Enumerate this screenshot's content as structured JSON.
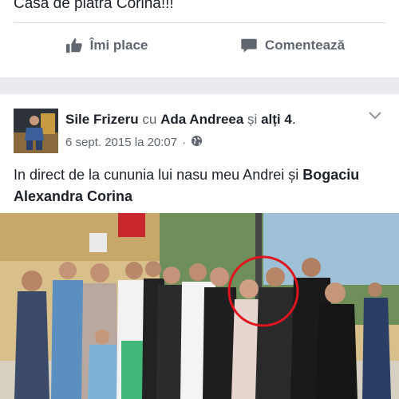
{
  "previous_post": {
    "text_fragment": "Casa de piatra Corina!!!"
  },
  "actions": {
    "like_label": "Îmi place",
    "comment_label": "Comentează"
  },
  "post": {
    "author": "Sile Frizeru",
    "with_word": "cu",
    "tagged_person": "Ada Andreea",
    "and_word": "și",
    "others": "alți 4",
    "period": ".",
    "date": "6 sept. 2015 la 20:07",
    "separator": "·",
    "text_intro": "In direct de la cununia lui nasu meu Andrei și",
    "text_name": "Bogaciu Alexandra Corina"
  },
  "colors": {
    "accent_red": "#e0141e",
    "muted": "#606770",
    "band": "#e9ebee"
  }
}
